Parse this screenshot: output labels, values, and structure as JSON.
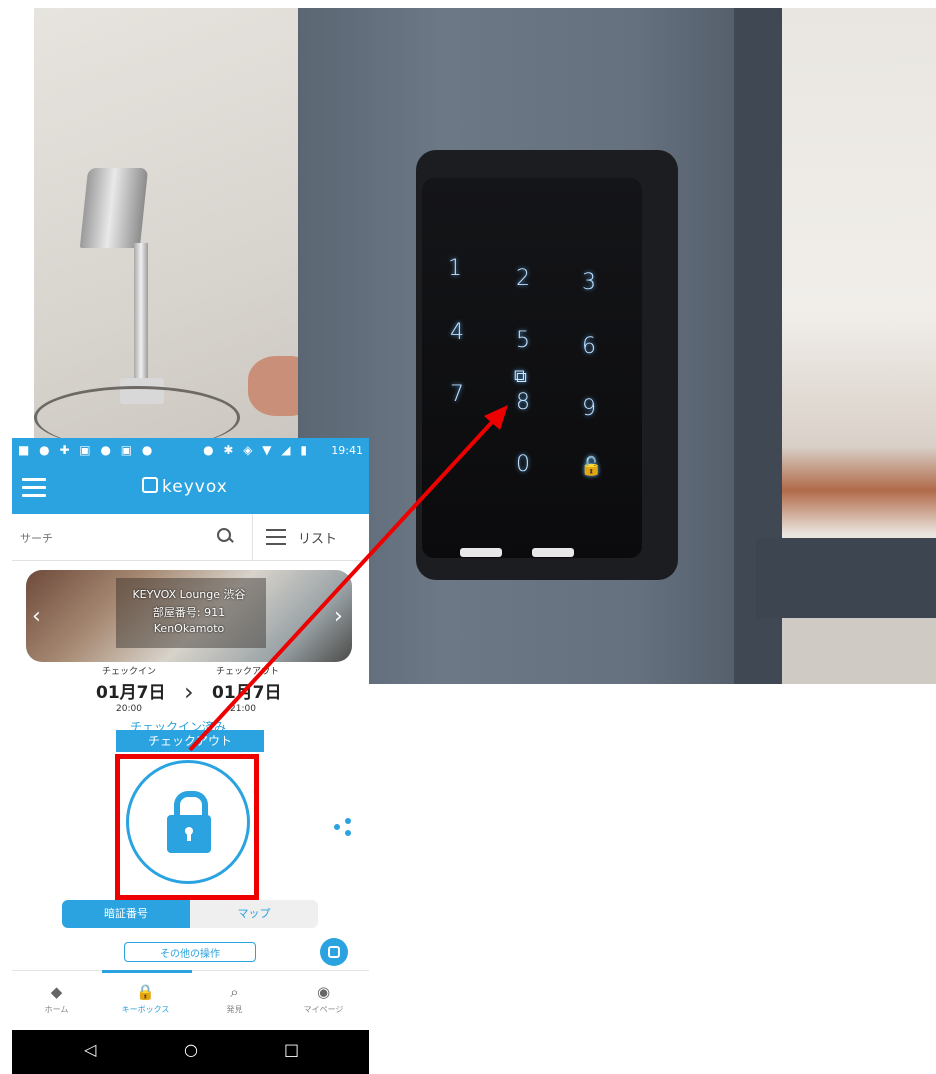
{
  "keypad": {
    "keys": [
      "1",
      "2",
      "3",
      "4",
      "5",
      "6",
      "7",
      "8",
      "9",
      "0"
    ],
    "logo_icon": "keyvox-logo-icon",
    "unlock_icon": "unlock-icon"
  },
  "status_bar": {
    "time": "19:41",
    "icons": [
      "message-icon",
      "chat-icon",
      "app-icon",
      "gallery-icon",
      "chat-icon",
      "gallery-icon",
      "line-icon",
      "location-icon",
      "bluetooth-icon",
      "vibrate-icon",
      "wifi-icon",
      "signal-icon",
      "battery-icon"
    ]
  },
  "app_bar": {
    "title": "keyvox",
    "menu_icon": "hamburger-icon"
  },
  "search": {
    "placeholder": "サーチ",
    "list_label": "リスト"
  },
  "property_card": {
    "name": "KEYVOX Lounge 渋谷",
    "room": "部屋番号: 911",
    "guest": "KenOkamoto"
  },
  "stay": {
    "checkin_label": "チェックイン",
    "checkin_date": "01月7日",
    "checkin_time": "20:00",
    "checkout_label": "チェックアウト",
    "checkout_date": "01月7日",
    "checkout_time": "21:00",
    "status": "チェックイン済み",
    "checkout_button": "チェックアウト"
  },
  "tabs": {
    "active": "暗証番号",
    "inactive": "マップ"
  },
  "other_ops": "その他の操作",
  "bottom_nav": [
    {
      "label": "ホーム",
      "icon": "diamond-icon"
    },
    {
      "label": "キーボックス",
      "icon": "lock-icon"
    },
    {
      "label": "発見",
      "icon": "search-icon"
    },
    {
      "label": "マイページ",
      "icon": "account-icon"
    }
  ],
  "colors": {
    "accent": "#2aa3e0",
    "annotation": "#ee0000"
  }
}
